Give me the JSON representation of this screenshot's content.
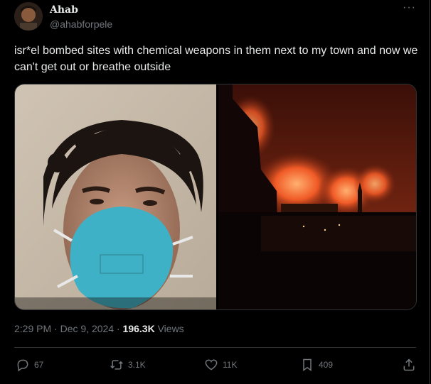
{
  "author": {
    "name": "Ahab",
    "handle": "@ahabforpele"
  },
  "post": {
    "text": "isr*el bombed sites with chemical weapons in them next to my town and now we can't get out or breathe outside",
    "time": "2:29 PM",
    "sep": " · ",
    "date": "Dec 9, 2024",
    "views_count": "196.3K",
    "views_label": "Views"
  },
  "actions": {
    "replies": "67",
    "reposts": "3.1K",
    "likes": "11K",
    "bookmarks": "409"
  },
  "colors": {
    "background": "#000000",
    "text": "#e7e9ea",
    "muted": "#71767b",
    "border": "#2f3336"
  },
  "icons": [
    "more-icon",
    "reply-icon",
    "repost-icon",
    "like-icon",
    "bookmark-icon",
    "share-icon"
  ]
}
